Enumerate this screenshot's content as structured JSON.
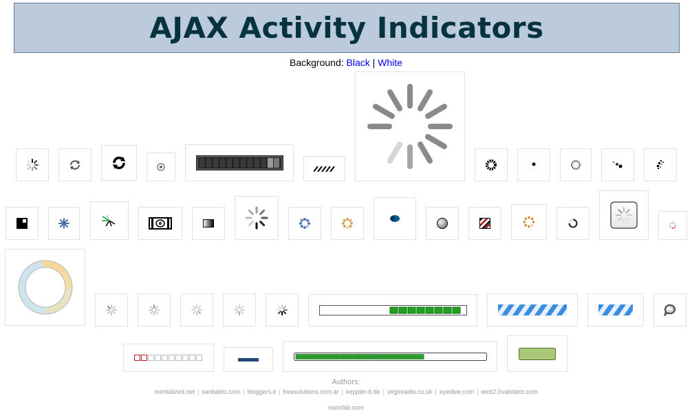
{
  "header": {
    "title": "AJAX Activity Indicators"
  },
  "background_switch": {
    "label": "Background:",
    "options": [
      "Black",
      "White"
    ],
    "separator": "|"
  },
  "footer": {
    "authors_label": "Authors:",
    "credits": [
      "mentalized.net",
      "sanbaldo.com",
      "bloggers.it",
      "freesolutions.com.ar",
      "keppler-it.de",
      "virginradio.co.uk",
      "eyedive.com",
      "web2.0validator.com"
    ],
    "last_credit": "naovfab.com"
  },
  "indicators": [
    {
      "id": "spinner-small-dark"
    },
    {
      "id": "refresh-arrows"
    },
    {
      "id": "refresh-arrows-bold"
    },
    {
      "id": "target-dot"
    },
    {
      "id": "progress-bar-dark"
    },
    {
      "id": "striped-bar"
    },
    {
      "id": "spinner-large-gray"
    },
    {
      "id": "spinning-dots-dark"
    },
    {
      "id": "single-dot"
    },
    {
      "id": "clock-ring"
    },
    {
      "id": "three-dots-diagonal"
    },
    {
      "id": "dot-cluster"
    },
    {
      "id": "black-square"
    },
    {
      "id": "blue-asterisk"
    },
    {
      "id": "green-burst"
    },
    {
      "id": "camera-frame"
    },
    {
      "id": "gradient-box"
    },
    {
      "id": "spinner-medium-gray"
    },
    {
      "id": "blue-dot-ring"
    },
    {
      "id": "orange-dot-ring"
    },
    {
      "id": "blue-oval"
    },
    {
      "id": "gray-sphere"
    },
    {
      "id": "striped-square"
    },
    {
      "id": "orange-square-ring"
    },
    {
      "id": "arc-ring"
    },
    {
      "id": "rounded-box-spinner"
    },
    {
      "id": "tiny-red-ring"
    },
    {
      "id": "pastel-circle"
    },
    {
      "id": "light-spinner-1"
    },
    {
      "id": "light-spinner-2"
    },
    {
      "id": "light-spinner-3"
    },
    {
      "id": "light-spinner-4"
    },
    {
      "id": "dark-spinner-small"
    },
    {
      "id": "green-block-bar"
    },
    {
      "id": "blue-stripe-bar-wide"
    },
    {
      "id": "blue-stripe-bar"
    },
    {
      "id": "chat-bubble-spinner"
    },
    {
      "id": "red-square-bar"
    },
    {
      "id": "navy-dash"
    },
    {
      "id": "green-progress-long"
    },
    {
      "id": "green-pill"
    }
  ],
  "colors": {
    "banner_bg": "#bccbdc",
    "banner_text": "#073240",
    "link": "#0000ee",
    "spinner_gray": "#8a8a8a",
    "progress_green": "#1fa31f",
    "stripe_blue": "#3a8de0"
  }
}
